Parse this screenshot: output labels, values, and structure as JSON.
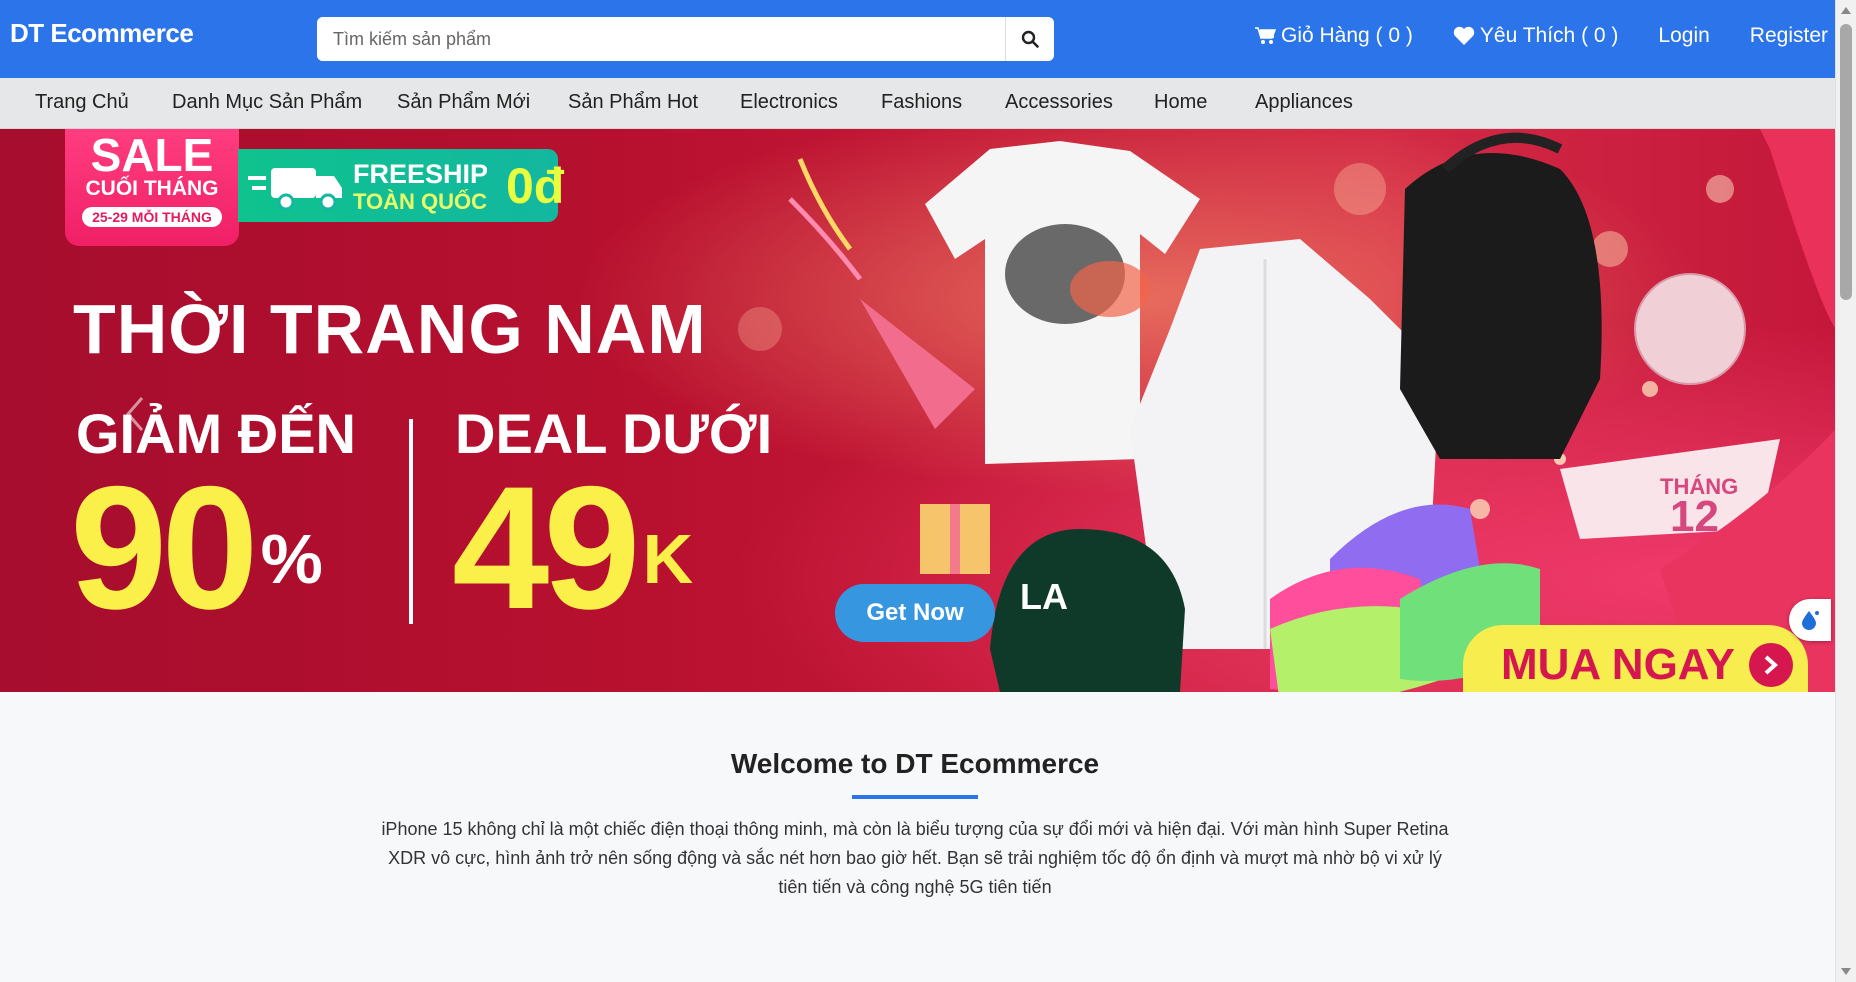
{
  "header": {
    "brand": "DT Ecommerce",
    "search_placeholder": "Tìm kiếm sản phẩm",
    "cart_label": "Giỏ Hàng ( 0 )",
    "wishlist_label": "Yêu Thích ( 0 )",
    "login_label": "Login",
    "register_label": "Register"
  },
  "nav": {
    "items": [
      "Trang Chủ",
      "Danh Mục Sản Phẩm",
      "Sản Phẩm Mới",
      "Sản Phẩm Hot",
      "Electronics",
      "Fashions",
      "Accessories",
      "Home",
      "Appliances"
    ]
  },
  "hero": {
    "sale_title": "SALE",
    "sale_sub": "CUỐI THÁNG",
    "sale_dates": "25-29 MỖI THÁNG",
    "freeship_line1": "FREESHIP",
    "freeship_line2": "TOÀN QUỐC",
    "freeship_price": "0đ",
    "title": "THỜI TRANG NAM",
    "discount_label": "GIẢM ĐẾN",
    "deal_label": "DEAL DƯỚI",
    "discount_value": "90",
    "discount_unit": "%",
    "deal_value": "49",
    "deal_unit": "K",
    "get_now_label": "Get Now",
    "buy_now_label": "MUA NGAY",
    "month_tag": "THÁNG 12"
  },
  "welcome": {
    "title": "Welcome to DT Ecommerce",
    "text": "iPhone 15 không chỉ là một chiếc điện thoại thông minh, mà còn là biểu tượng của sự đổi mới và hiện đại. Với màn hình Super Retina XDR vô cực, hình ảnh trở nên sống động và sắc nét hơn bao giờ hết. Bạn sẽ trải nghiệm tốc độ ổn định và mượt mà nhờ bộ vi xử lý tiên tiến và công nghệ 5G tiên tiến"
  },
  "colors": {
    "header_bg": "#2c74ea",
    "nav_bg": "#e6e7e8",
    "accent_yellow": "#fbf04a",
    "button_blue": "#3796e0"
  }
}
